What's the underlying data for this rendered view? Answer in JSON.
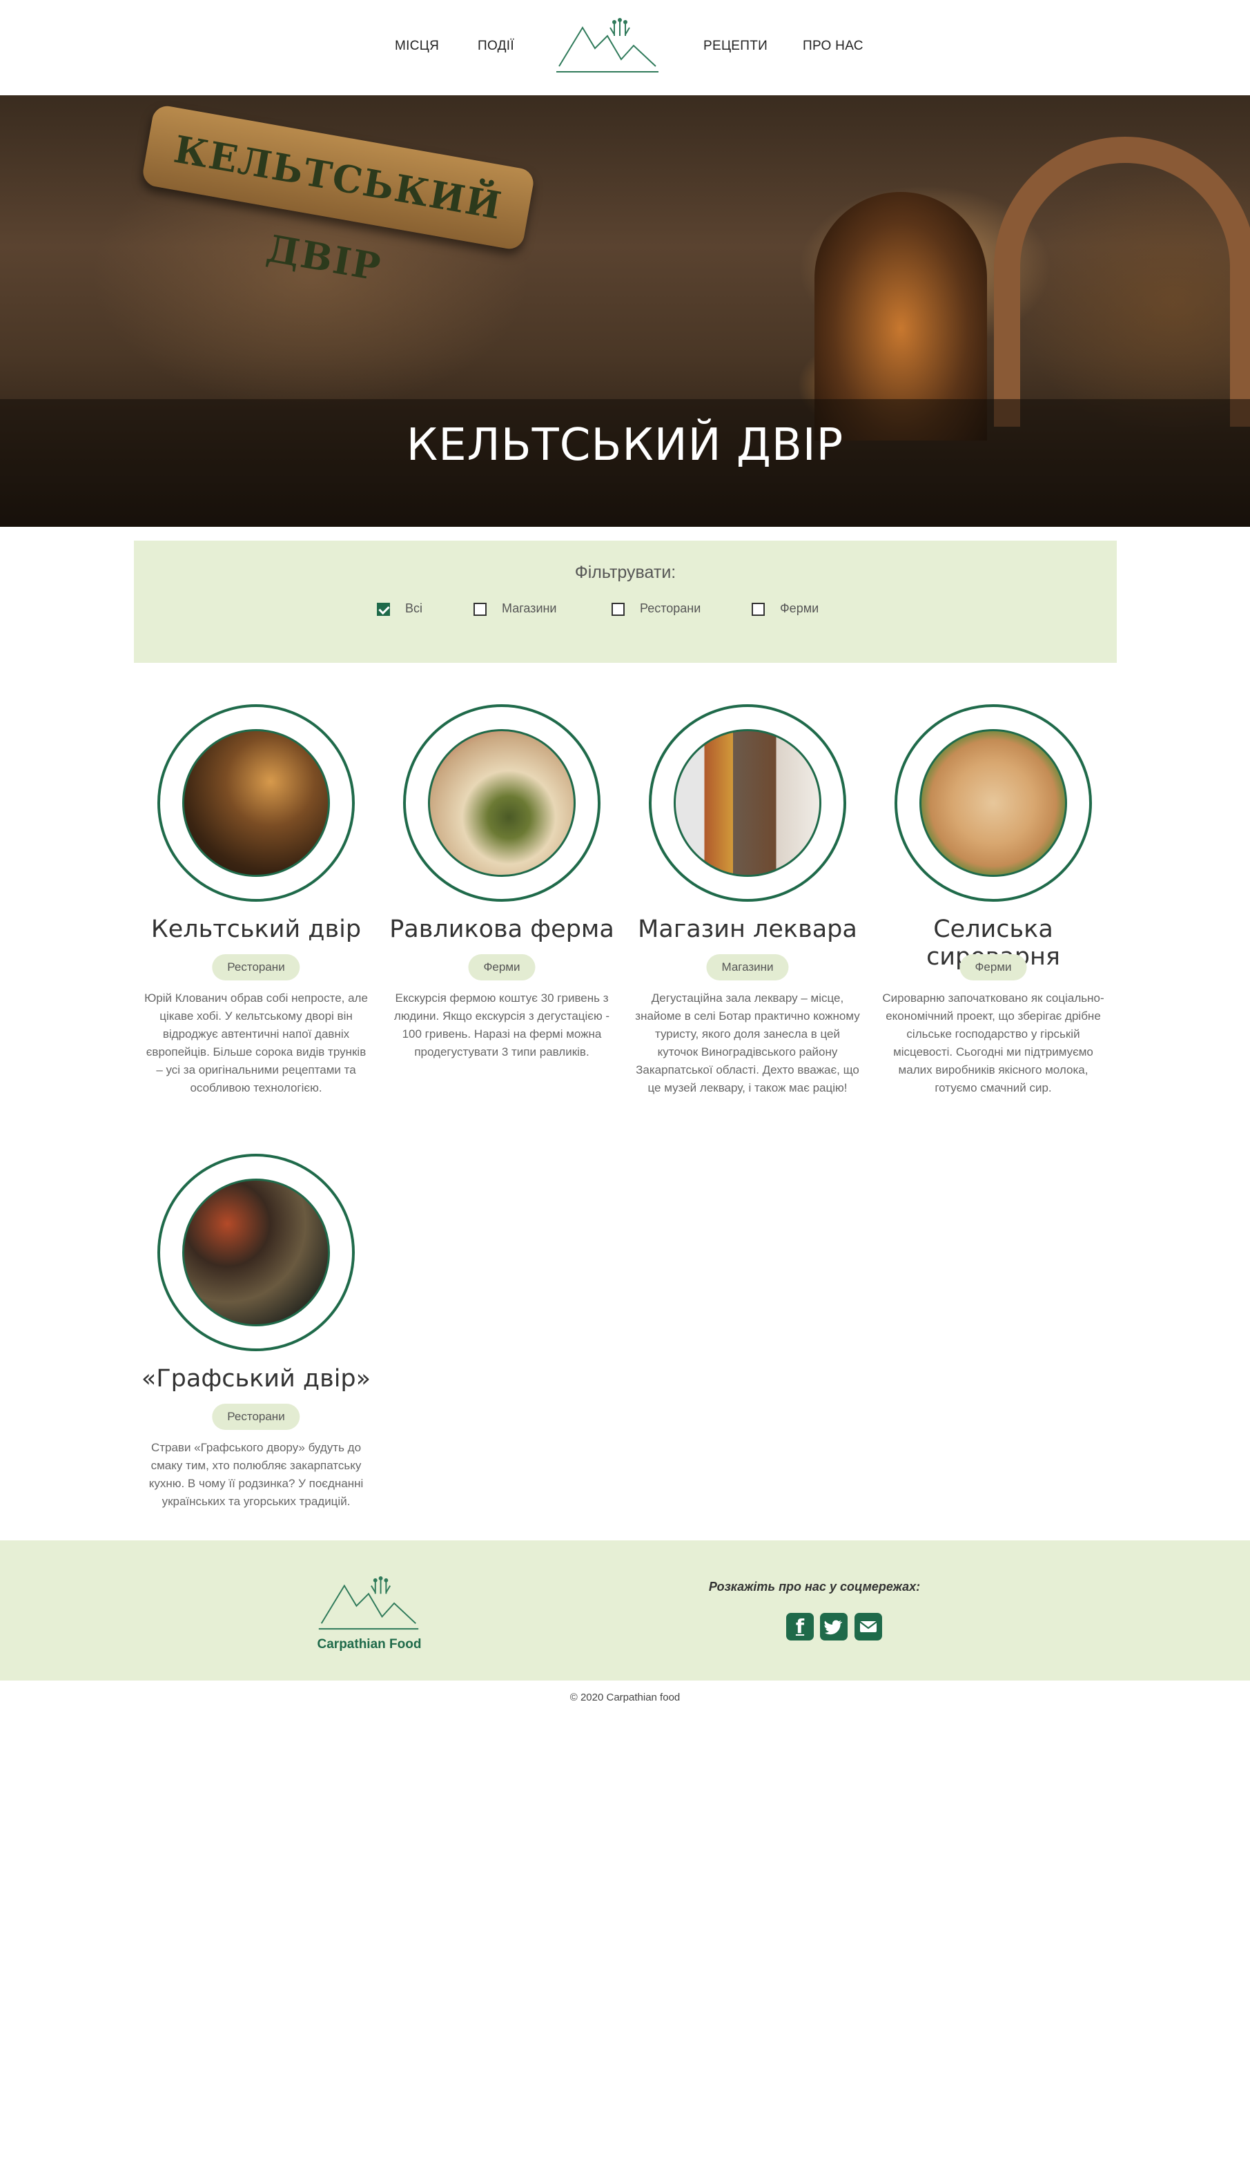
{
  "nav": {
    "items": [
      {
        "label": "МІСЦЯ"
      },
      {
        "label": "ПОДІЇ"
      },
      {
        "label": "РЕЦЕПТИ"
      },
      {
        "label": "ПРО НАС"
      }
    ]
  },
  "hero": {
    "title": "КЕЛЬТСЬКИЙ ДВІР",
    "sign_text": "КЕЛЬТСЬКИЙ ДВІР"
  },
  "filter": {
    "title": "Фільтрувати:",
    "options": [
      {
        "label": "Всі",
        "checked": true
      },
      {
        "label": "Магазини",
        "checked": false
      },
      {
        "label": "Ресторани",
        "checked": false
      },
      {
        "label": "Ферми",
        "checked": false
      }
    ]
  },
  "places": [
    {
      "name": "Кельтський двір",
      "tag": "Ресторани",
      "desc": "Юрій Клованич обрав собі непросте, але цікаве хобі. У кельтському дворі він відроджує автентичні напої давніх європейців. Більше сорока видів трунків – усі за оригінальними рецептами та особливою технологією."
    },
    {
      "name": "Равликова ферма",
      "tag": "Ферми",
      "desc": "Екскурсія фермою коштує 30 гривень з людини. Якщо екскурсія з дегустацією - 100 гривень. Наразі на фермі можна продегустувати 3 типи равликів."
    },
    {
      "name": "Магазин леквара",
      "tag": "Магазини",
      "desc": "Дегустаційна зала леквару – місце, знайоме в селі Ботар практично кожному туристу, якого доля занесла в цей куточок Виноградівського району Закарпатської області. Дехто вважає, що це музей леквару, і також має рацію!"
    },
    {
      "name": "Селиська сироварня",
      "tag": "Ферми",
      "desc": "Сироварню започатковано як соціально-економічний проект, що зберігає дрібне сільське господарство у гірській місцевості. Сьогодні ми підтримуємо малих виробників якісного молока, готуємо смачний сир."
    },
    {
      "name": "«Графський двір»",
      "tag": "Ресторани",
      "desc": "Страви «Графського двору» будуть до смаку тим, хто полюбляє закарпатську кухню. В чому її родзинка? У поєднанні українських та угорських традицій."
    }
  ],
  "footer": {
    "brand": "Carpathian Food",
    "share_text": "Розкажіть про нас у соцмережах:",
    "social": [
      {
        "icon": "facebook-icon",
        "glyph": "f"
      },
      {
        "icon": "twitter-icon",
        "glyph": "t"
      },
      {
        "icon": "envelope-icon",
        "glyph": "✉"
      }
    ],
    "copyright": "© 2020 Carpathian food"
  },
  "colors": {
    "accent": "#1f6a4a",
    "panel": "#e6efd5"
  }
}
